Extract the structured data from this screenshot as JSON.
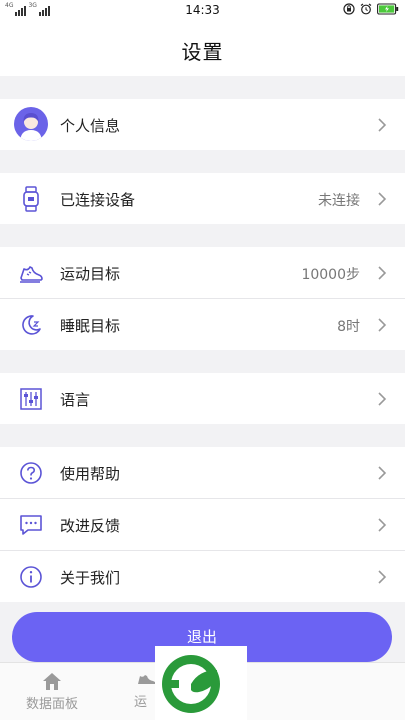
{
  "status_bar": {
    "signal_label_1": "4G",
    "signal_label_2": "3G",
    "time": "14:33"
  },
  "header": {
    "title": "设置"
  },
  "rows": {
    "personal_info": {
      "label": "个人信息",
      "icon": "avatar"
    },
    "connected_device": {
      "label": "已连接设备",
      "value": "未连接",
      "icon": "watch-icon"
    },
    "exercise_goal": {
      "label": "运动目标",
      "value": "10000步",
      "icon": "sneaker-icon"
    },
    "sleep_goal": {
      "label": "睡眠目标",
      "value": "8时",
      "icon": "moon-icon"
    },
    "language": {
      "label": "语言",
      "icon": "sliders-icon"
    },
    "help": {
      "label": "使用帮助",
      "icon": "question-icon"
    },
    "feedback": {
      "label": "改进反馈",
      "icon": "chat-icon"
    },
    "about": {
      "label": "关于我们",
      "icon": "info-icon"
    }
  },
  "logout": {
    "label": "退出"
  },
  "bottom_nav": {
    "items": [
      {
        "label": "数据面板",
        "icon": "home-icon"
      },
      {
        "label": "运",
        "icon": "sneaker-icon"
      }
    ]
  },
  "colors": {
    "accent": "#6b63f3",
    "icon": "#5b54d6",
    "background": "#f2f2f4"
  }
}
